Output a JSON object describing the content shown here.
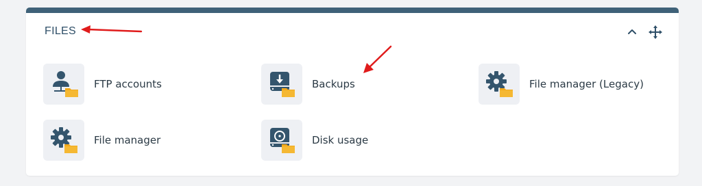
{
  "panel": {
    "title": "FILES",
    "controls": {
      "collapse_icon": "chevron-up-icon",
      "move_icon": "move-arrows-icon"
    }
  },
  "items": [
    {
      "label": "FTP accounts",
      "icon": "ftp-user-folder-icon"
    },
    {
      "label": "Backups",
      "icon": "backup-drive-folder-icon"
    },
    {
      "label": "File manager (Legacy)",
      "icon": "gear-folder-icon"
    },
    {
      "label": "File manager",
      "icon": "gear-folder-icon"
    },
    {
      "label": "Disk usage",
      "icon": "disk-folder-icon"
    }
  ],
  "annotations": {
    "arrow_color": "#e01b1b"
  },
  "colors": {
    "topbar": "#3f6178",
    "icon_dark": "#34556d",
    "folder": "#f2a91a"
  }
}
